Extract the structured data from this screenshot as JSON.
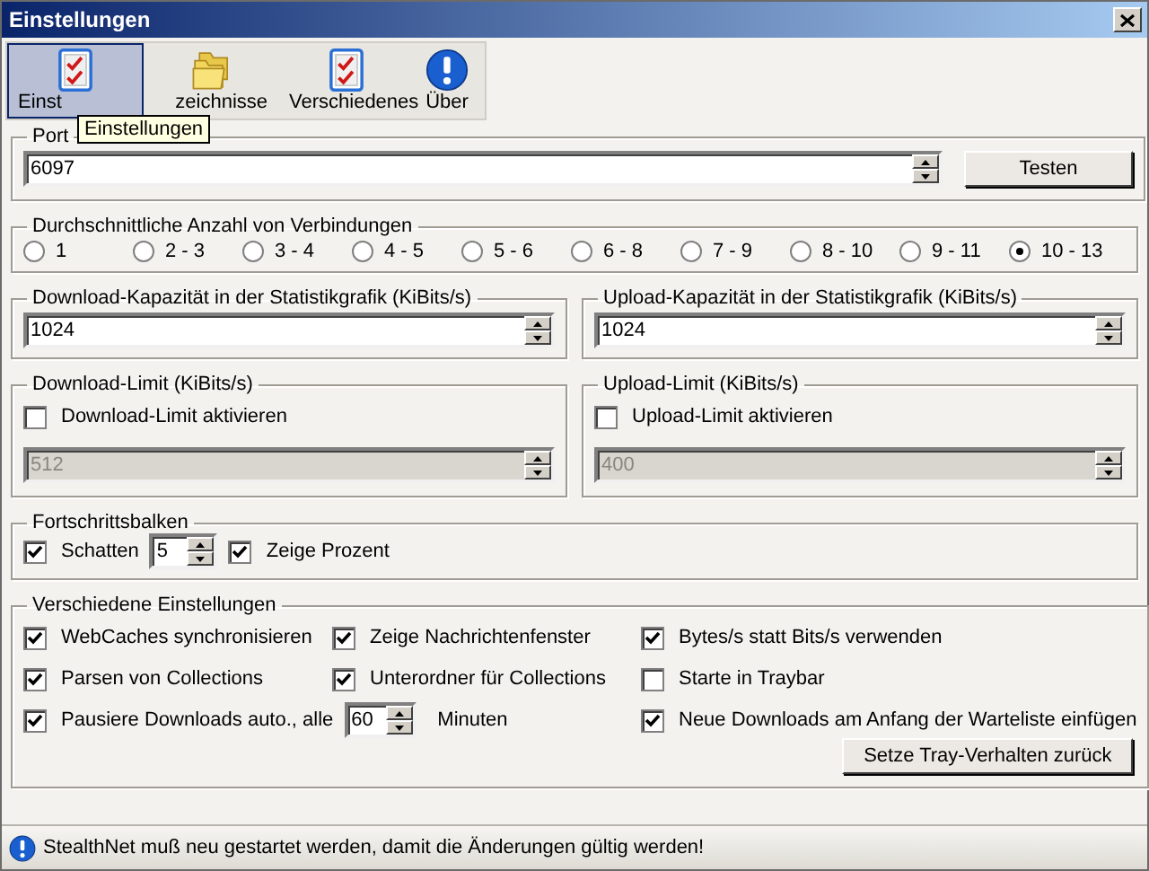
{
  "window": {
    "title": "Einstellungen"
  },
  "tabs": [
    {
      "label": "Einst",
      "selected": true,
      "kind": "checklist"
    },
    {
      "label": "zeichnisse",
      "selected": false,
      "kind": "folders"
    },
    {
      "label": "Verschiedenes",
      "selected": false,
      "kind": "checklist"
    },
    {
      "label": "Über",
      "selected": false,
      "kind": "info"
    }
  ],
  "tooltip": "Einstellungen",
  "port": {
    "title": "Port",
    "value": "6097",
    "button": "Testen"
  },
  "connections": {
    "title": "Durchschnittliche Anzahl von Verbindungen",
    "options": [
      {
        "label": "1",
        "selected": false
      },
      {
        "label": "2 - 3",
        "selected": false
      },
      {
        "label": "3 - 4",
        "selected": false
      },
      {
        "label": "4 - 5",
        "selected": false
      },
      {
        "label": "5 - 6",
        "selected": false
      },
      {
        "label": "6 - 8",
        "selected": false
      },
      {
        "label": "7 - 9",
        "selected": false
      },
      {
        "label": "8 - 10",
        "selected": false
      },
      {
        "label": "9 - 11",
        "selected": false
      },
      {
        "label": "10 - 13",
        "selected": true
      }
    ]
  },
  "capacity": [
    {
      "title": "Download-Kapazität in der Statistikgrafik  (KiBits/s)",
      "value": "1024"
    },
    {
      "title": "Upload-Kapazität in der Statistikgrafik (KiBits/s)",
      "value": "1024"
    }
  ],
  "limits": [
    {
      "title": "Download-Limit (KiBits/s)",
      "label": "Download-Limit aktivieren",
      "checked": false,
      "value": "512",
      "disabled": true
    },
    {
      "title": "Upload-Limit (KiBits/s)",
      "label": "Upload-Limit aktivieren",
      "checked": false,
      "value": "400",
      "disabled": true
    }
  ],
  "progress": {
    "title": "Fortschrittsbalken",
    "items": [
      {
        "kind": "check",
        "label": "Schatten",
        "checked": true
      },
      {
        "kind": "spin",
        "value": "5"
      },
      {
        "kind": "check",
        "label": "Zeige Prozent",
        "checked": true
      }
    ]
  },
  "misc": {
    "title": "Verschiedene Einstellungen",
    "items": [
      {
        "kind": "check",
        "label": "WebCaches synchronisieren",
        "checked": true
      },
      {
        "kind": "check",
        "label": "Zeige Nachrichtenfenster",
        "checked": true
      },
      {
        "kind": "check",
        "label": "Bytes/s statt Bits/s verwenden",
        "checked": true
      },
      {
        "kind": "check",
        "label": "Parsen von Collections",
        "checked": true
      },
      {
        "kind": "check",
        "label": "Unterordner für Collections",
        "checked": true
      },
      {
        "kind": "check",
        "label": "Starte in Traybar",
        "checked": false
      },
      {
        "kind": "check_spin",
        "label": "Pausiere Downloads auto., alle",
        "checked": true,
        "value": "60",
        "unit": "Minuten"
      },
      {
        "kind": "check",
        "label": "Neue Downloads am Anfang der Warteliste einfügen",
        "checked": true
      }
    ],
    "button": "Setze Tray-Verhalten zurück"
  },
  "status": {
    "text": "StealthNet muß neu gestartet werden, damit die Änderungen gültig werden!"
  }
}
